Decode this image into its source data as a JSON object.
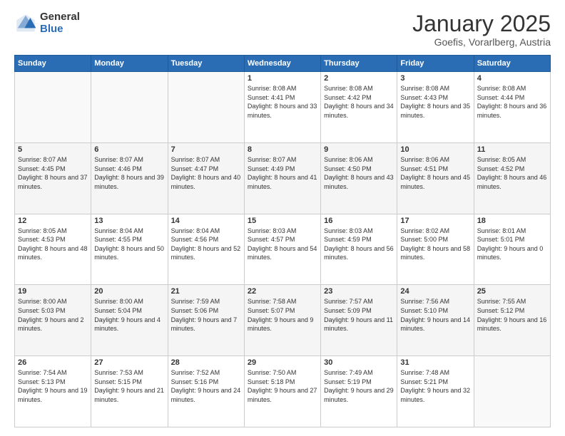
{
  "logo": {
    "general": "General",
    "blue": "Blue"
  },
  "header": {
    "month": "January 2025",
    "location": "Goefis, Vorarlberg, Austria"
  },
  "weekdays": [
    "Sunday",
    "Monday",
    "Tuesday",
    "Wednesday",
    "Thursday",
    "Friday",
    "Saturday"
  ],
  "weeks": [
    [
      {
        "day": "",
        "sunrise": "",
        "sunset": "",
        "daylight": ""
      },
      {
        "day": "",
        "sunrise": "",
        "sunset": "",
        "daylight": ""
      },
      {
        "day": "",
        "sunrise": "",
        "sunset": "",
        "daylight": ""
      },
      {
        "day": "1",
        "sunrise": "Sunrise: 8:08 AM",
        "sunset": "Sunset: 4:41 PM",
        "daylight": "Daylight: 8 hours and 33 minutes."
      },
      {
        "day": "2",
        "sunrise": "Sunrise: 8:08 AM",
        "sunset": "Sunset: 4:42 PM",
        "daylight": "Daylight: 8 hours and 34 minutes."
      },
      {
        "day": "3",
        "sunrise": "Sunrise: 8:08 AM",
        "sunset": "Sunset: 4:43 PM",
        "daylight": "Daylight: 8 hours and 35 minutes."
      },
      {
        "day": "4",
        "sunrise": "Sunrise: 8:08 AM",
        "sunset": "Sunset: 4:44 PM",
        "daylight": "Daylight: 8 hours and 36 minutes."
      }
    ],
    [
      {
        "day": "5",
        "sunrise": "Sunrise: 8:07 AM",
        "sunset": "Sunset: 4:45 PM",
        "daylight": "Daylight: 8 hours and 37 minutes."
      },
      {
        "day": "6",
        "sunrise": "Sunrise: 8:07 AM",
        "sunset": "Sunset: 4:46 PM",
        "daylight": "Daylight: 8 hours and 39 minutes."
      },
      {
        "day": "7",
        "sunrise": "Sunrise: 8:07 AM",
        "sunset": "Sunset: 4:47 PM",
        "daylight": "Daylight: 8 hours and 40 minutes."
      },
      {
        "day": "8",
        "sunrise": "Sunrise: 8:07 AM",
        "sunset": "Sunset: 4:49 PM",
        "daylight": "Daylight: 8 hours and 41 minutes."
      },
      {
        "day": "9",
        "sunrise": "Sunrise: 8:06 AM",
        "sunset": "Sunset: 4:50 PM",
        "daylight": "Daylight: 8 hours and 43 minutes."
      },
      {
        "day": "10",
        "sunrise": "Sunrise: 8:06 AM",
        "sunset": "Sunset: 4:51 PM",
        "daylight": "Daylight: 8 hours and 45 minutes."
      },
      {
        "day": "11",
        "sunrise": "Sunrise: 8:05 AM",
        "sunset": "Sunset: 4:52 PM",
        "daylight": "Daylight: 8 hours and 46 minutes."
      }
    ],
    [
      {
        "day": "12",
        "sunrise": "Sunrise: 8:05 AM",
        "sunset": "Sunset: 4:53 PM",
        "daylight": "Daylight: 8 hours and 48 minutes."
      },
      {
        "day": "13",
        "sunrise": "Sunrise: 8:04 AM",
        "sunset": "Sunset: 4:55 PM",
        "daylight": "Daylight: 8 hours and 50 minutes."
      },
      {
        "day": "14",
        "sunrise": "Sunrise: 8:04 AM",
        "sunset": "Sunset: 4:56 PM",
        "daylight": "Daylight: 8 hours and 52 minutes."
      },
      {
        "day": "15",
        "sunrise": "Sunrise: 8:03 AM",
        "sunset": "Sunset: 4:57 PM",
        "daylight": "Daylight: 8 hours and 54 minutes."
      },
      {
        "day": "16",
        "sunrise": "Sunrise: 8:03 AM",
        "sunset": "Sunset: 4:59 PM",
        "daylight": "Daylight: 8 hours and 56 minutes."
      },
      {
        "day": "17",
        "sunrise": "Sunrise: 8:02 AM",
        "sunset": "Sunset: 5:00 PM",
        "daylight": "Daylight: 8 hours and 58 minutes."
      },
      {
        "day": "18",
        "sunrise": "Sunrise: 8:01 AM",
        "sunset": "Sunset: 5:01 PM",
        "daylight": "Daylight: 9 hours and 0 minutes."
      }
    ],
    [
      {
        "day": "19",
        "sunrise": "Sunrise: 8:00 AM",
        "sunset": "Sunset: 5:03 PM",
        "daylight": "Daylight: 9 hours and 2 minutes."
      },
      {
        "day": "20",
        "sunrise": "Sunrise: 8:00 AM",
        "sunset": "Sunset: 5:04 PM",
        "daylight": "Daylight: 9 hours and 4 minutes."
      },
      {
        "day": "21",
        "sunrise": "Sunrise: 7:59 AM",
        "sunset": "Sunset: 5:06 PM",
        "daylight": "Daylight: 9 hours and 7 minutes."
      },
      {
        "day": "22",
        "sunrise": "Sunrise: 7:58 AM",
        "sunset": "Sunset: 5:07 PM",
        "daylight": "Daylight: 9 hours and 9 minutes."
      },
      {
        "day": "23",
        "sunrise": "Sunrise: 7:57 AM",
        "sunset": "Sunset: 5:09 PM",
        "daylight": "Daylight: 9 hours and 11 minutes."
      },
      {
        "day": "24",
        "sunrise": "Sunrise: 7:56 AM",
        "sunset": "Sunset: 5:10 PM",
        "daylight": "Daylight: 9 hours and 14 minutes."
      },
      {
        "day": "25",
        "sunrise": "Sunrise: 7:55 AM",
        "sunset": "Sunset: 5:12 PM",
        "daylight": "Daylight: 9 hours and 16 minutes."
      }
    ],
    [
      {
        "day": "26",
        "sunrise": "Sunrise: 7:54 AM",
        "sunset": "Sunset: 5:13 PM",
        "daylight": "Daylight: 9 hours and 19 minutes."
      },
      {
        "day": "27",
        "sunrise": "Sunrise: 7:53 AM",
        "sunset": "Sunset: 5:15 PM",
        "daylight": "Daylight: 9 hours and 21 minutes."
      },
      {
        "day": "28",
        "sunrise": "Sunrise: 7:52 AM",
        "sunset": "Sunset: 5:16 PM",
        "daylight": "Daylight: 9 hours and 24 minutes."
      },
      {
        "day": "29",
        "sunrise": "Sunrise: 7:50 AM",
        "sunset": "Sunset: 5:18 PM",
        "daylight": "Daylight: 9 hours and 27 minutes."
      },
      {
        "day": "30",
        "sunrise": "Sunrise: 7:49 AM",
        "sunset": "Sunset: 5:19 PM",
        "daylight": "Daylight: 9 hours and 29 minutes."
      },
      {
        "day": "31",
        "sunrise": "Sunrise: 7:48 AM",
        "sunset": "Sunset: 5:21 PM",
        "daylight": "Daylight: 9 hours and 32 minutes."
      },
      {
        "day": "",
        "sunrise": "",
        "sunset": "",
        "daylight": ""
      }
    ]
  ]
}
